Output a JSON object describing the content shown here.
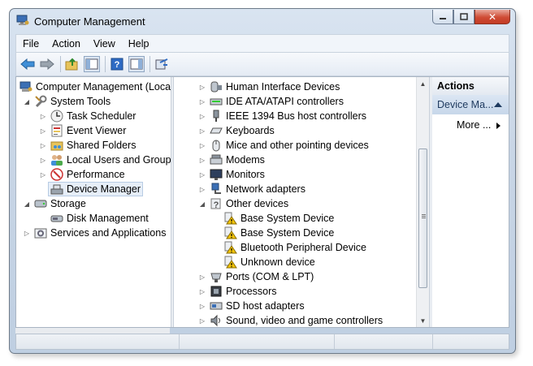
{
  "window": {
    "title": "Computer Management"
  },
  "caption": {
    "minimize_icon": "minimize-icon",
    "maximize_icon": "maximize-icon",
    "close_label": "✕"
  },
  "menu": [
    "File",
    "Action",
    "View",
    "Help"
  ],
  "toolbar_icons": [
    "back-arrow-icon",
    "forward-arrow-icon",
    "up-folder-icon",
    "show-hide-console-tree-icon",
    "help-icon",
    "show-hide-action-pane-icon",
    "properties-icon"
  ],
  "tree": {
    "root": "Computer Management (Local",
    "system_tools": "System Tools",
    "task_scheduler": "Task Scheduler",
    "event_viewer": "Event Viewer",
    "shared_folders": "Shared Folders",
    "local_users": "Local Users and Groups",
    "performance": "Performance",
    "device_manager": "Device Manager",
    "storage": "Storage",
    "disk_management": "Disk Management",
    "services": "Services and Applications"
  },
  "devices": {
    "hid": "Human Interface Devices",
    "ide": "IDE ATA/ATAPI controllers",
    "ieee": "IEEE 1394 Bus host controllers",
    "keyboards": "Keyboards",
    "mice": "Mice and other pointing devices",
    "modems": "Modems",
    "monitors": "Monitors",
    "network": "Network adapters",
    "other": "Other devices",
    "base1": "Base System Device",
    "base2": "Base System Device",
    "bluetooth": "Bluetooth Peripheral Device",
    "unknown": "Unknown device",
    "ports": "Ports (COM & LPT)",
    "processors": "Processors",
    "sd": "SD host adapters",
    "sound": "Sound, video and game controllers"
  },
  "actions": {
    "header": "Actions",
    "section": "Device Ma...",
    "more": "More ..."
  },
  "colors": {
    "selection": "#e6eef8",
    "warning": "#f2c40a",
    "accent": "#1e3a5f"
  }
}
